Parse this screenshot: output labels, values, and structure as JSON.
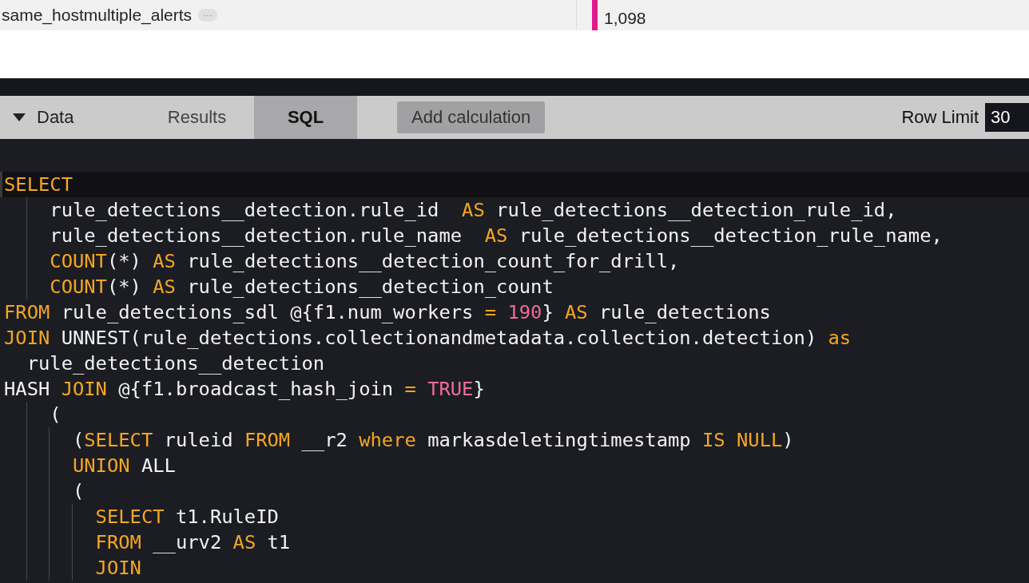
{
  "result_row": {
    "dimension": "same_hostmultiple_alerts",
    "more": "···",
    "measure": "1,098"
  },
  "tabs": [
    {
      "label": "Data",
      "kind": "toggle",
      "expanded": true,
      "selected": false
    },
    {
      "label": "Results",
      "kind": "tab",
      "selected": false
    },
    {
      "label": "SQL",
      "kind": "tab",
      "selected": true
    }
  ],
  "add_calculation": "Add calculation",
  "row_limit": {
    "label": "Row Limit",
    "value": "30"
  },
  "sql_lines": [
    {
      "current": true,
      "tokens": [
        {
          "kind": "keyword",
          "text": "SELECT"
        }
      ]
    },
    {
      "current": false,
      "tokens": [
        {
          "kind": "plain",
          "text": "    rule_detections__detection.rule_id  "
        },
        {
          "kind": "keyword",
          "text": "AS"
        },
        {
          "kind": "plain",
          "text": " rule_detections__detection_rule_id,"
        }
      ]
    },
    {
      "current": false,
      "tokens": [
        {
          "kind": "plain",
          "text": "    rule_detections__detection.rule_name  "
        },
        {
          "kind": "keyword",
          "text": "AS"
        },
        {
          "kind": "plain",
          "text": " rule_detections__detection_rule_name,"
        }
      ]
    },
    {
      "current": false,
      "tokens": [
        {
          "kind": "keyword",
          "text": "    COUNT"
        },
        {
          "kind": "plain",
          "text": "(*) "
        },
        {
          "kind": "keyword",
          "text": "AS"
        },
        {
          "kind": "plain",
          "text": " rule_detections__detection_count_for_drill,"
        }
      ]
    },
    {
      "current": false,
      "tokens": [
        {
          "kind": "keyword",
          "text": "    COUNT"
        },
        {
          "kind": "plain",
          "text": "(*) "
        },
        {
          "kind": "keyword",
          "text": "AS"
        },
        {
          "kind": "plain",
          "text": " rule_detections__detection_count"
        }
      ]
    },
    {
      "current": false,
      "tokens": [
        {
          "kind": "keyword",
          "text": "FROM"
        },
        {
          "kind": "plain",
          "text": " rule_detections_sdl @{f1.num_workers "
        },
        {
          "kind": "keyword",
          "text": "= "
        },
        {
          "kind": "literal",
          "text": "190"
        },
        {
          "kind": "plain",
          "text": "} "
        },
        {
          "kind": "keyword",
          "text": "AS"
        },
        {
          "kind": "plain",
          "text": " rule_detections"
        }
      ]
    },
    {
      "current": false,
      "tokens": [
        {
          "kind": "keyword",
          "text": "JOIN"
        },
        {
          "kind": "plain",
          "text": " UNNEST(rule_detections.collectionandmetadata.collection.detection) "
        },
        {
          "kind": "keyword",
          "text": "as"
        }
      ]
    },
    {
      "current": false,
      "tokens": [
        {
          "kind": "plain",
          "text": "  rule_detections__detection"
        }
      ]
    },
    {
      "current": false,
      "tokens": [
        {
          "kind": "plain",
          "text": "HASH "
        },
        {
          "kind": "keyword",
          "text": "JOIN"
        },
        {
          "kind": "plain",
          "text": " @{f1.broadcast_hash_join "
        },
        {
          "kind": "keyword",
          "text": "= "
        },
        {
          "kind": "literal",
          "text": "TRUE"
        },
        {
          "kind": "plain",
          "text": "}"
        }
      ]
    },
    {
      "current": false,
      "tokens": [
        {
          "kind": "plain",
          "text": "    ("
        }
      ]
    },
    {
      "current": false,
      "tokens": [
        {
          "kind": "plain",
          "text": "      ("
        },
        {
          "kind": "keyword",
          "text": "SELECT"
        },
        {
          "kind": "plain",
          "text": " ruleid "
        },
        {
          "kind": "keyword",
          "text": "FROM"
        },
        {
          "kind": "plain",
          "text": " __r2 "
        },
        {
          "kind": "keyword",
          "text": "where"
        },
        {
          "kind": "plain",
          "text": " markasdeletingtimestamp "
        },
        {
          "kind": "keyword",
          "text": "IS NULL"
        },
        {
          "kind": "plain",
          "text": ")"
        }
      ]
    },
    {
      "current": false,
      "tokens": [
        {
          "kind": "keyword",
          "text": "      UNION"
        },
        {
          "kind": "plain",
          "text": " ALL"
        }
      ]
    },
    {
      "current": false,
      "tokens": [
        {
          "kind": "plain",
          "text": "      ("
        }
      ]
    },
    {
      "current": false,
      "tokens": [
        {
          "kind": "keyword",
          "text": "        SELECT"
        },
        {
          "kind": "plain",
          "text": " t1.RuleID"
        }
      ]
    },
    {
      "current": false,
      "tokens": [
        {
          "kind": "keyword",
          "text": "        FROM"
        },
        {
          "kind": "plain",
          "text": " __urv2 "
        },
        {
          "kind": "keyword",
          "text": "AS"
        },
        {
          "kind": "plain",
          "text": " t1"
        }
      ]
    },
    {
      "current": false,
      "tokens": [
        {
          "kind": "keyword",
          "text": "        JOIN"
        }
      ]
    }
  ]
}
